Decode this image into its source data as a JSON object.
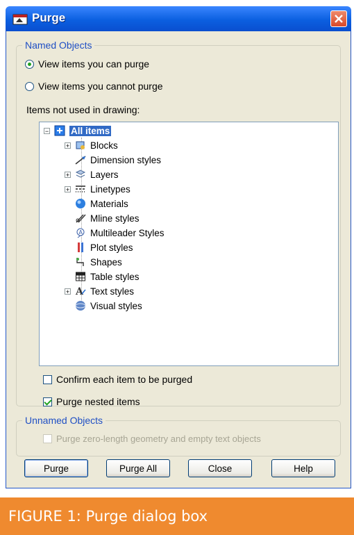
{
  "window": {
    "title": "Purge"
  },
  "named_objects": {
    "legend": "Named Objects",
    "radio_can": "View items you can purge",
    "radio_cannot": "View items you cannot purge",
    "selected_radio": "can",
    "items_label": "Items not used in drawing:",
    "tree": [
      {
        "label": "All items",
        "selected": true,
        "expandable": true,
        "expanded": true,
        "icon": "all-items-icon"
      },
      {
        "label": "Blocks",
        "expandable": true,
        "icon": "blocks-icon"
      },
      {
        "label": "Dimension styles",
        "expandable": false,
        "icon": "dimension-styles-icon"
      },
      {
        "label": "Layers",
        "expandable": true,
        "icon": "layers-icon"
      },
      {
        "label": "Linetypes",
        "expandable": true,
        "icon": "linetypes-icon"
      },
      {
        "label": "Materials",
        "expandable": false,
        "icon": "materials-icon"
      },
      {
        "label": "Mline styles",
        "expandable": false,
        "icon": "mline-styles-icon"
      },
      {
        "label": "Multileader Styles",
        "expandable": false,
        "icon": "multileader-styles-icon"
      },
      {
        "label": "Plot styles",
        "expandable": false,
        "icon": "plot-styles-icon"
      },
      {
        "label": "Shapes",
        "expandable": false,
        "icon": "shapes-icon"
      },
      {
        "label": "Table styles",
        "expandable": false,
        "icon": "table-styles-icon"
      },
      {
        "label": "Text styles",
        "expandable": true,
        "icon": "text-styles-icon"
      },
      {
        "label": "Visual styles",
        "expandable": false,
        "icon": "visual-styles-icon"
      }
    ],
    "confirm_label": "Confirm each item to be purged",
    "confirm_checked": false,
    "nested_label": "Purge nested items",
    "nested_checked": true
  },
  "unnamed_objects": {
    "legend": "Unnamed Objects",
    "zero_length_label": "Purge zero-length geometry and empty text objects",
    "zero_length_checked": false,
    "enabled": false
  },
  "buttons": {
    "purge": "Purge",
    "purge_all": "Purge All",
    "close": "Close",
    "help": "Help"
  },
  "caption": "FIGURE 1: Purge dialog box",
  "colors": {
    "title_bar": "#0b5fe0",
    "caption_bg": "#ef8a2f",
    "selection": "#316ac5",
    "dialog_bg": "#ece9d8"
  }
}
